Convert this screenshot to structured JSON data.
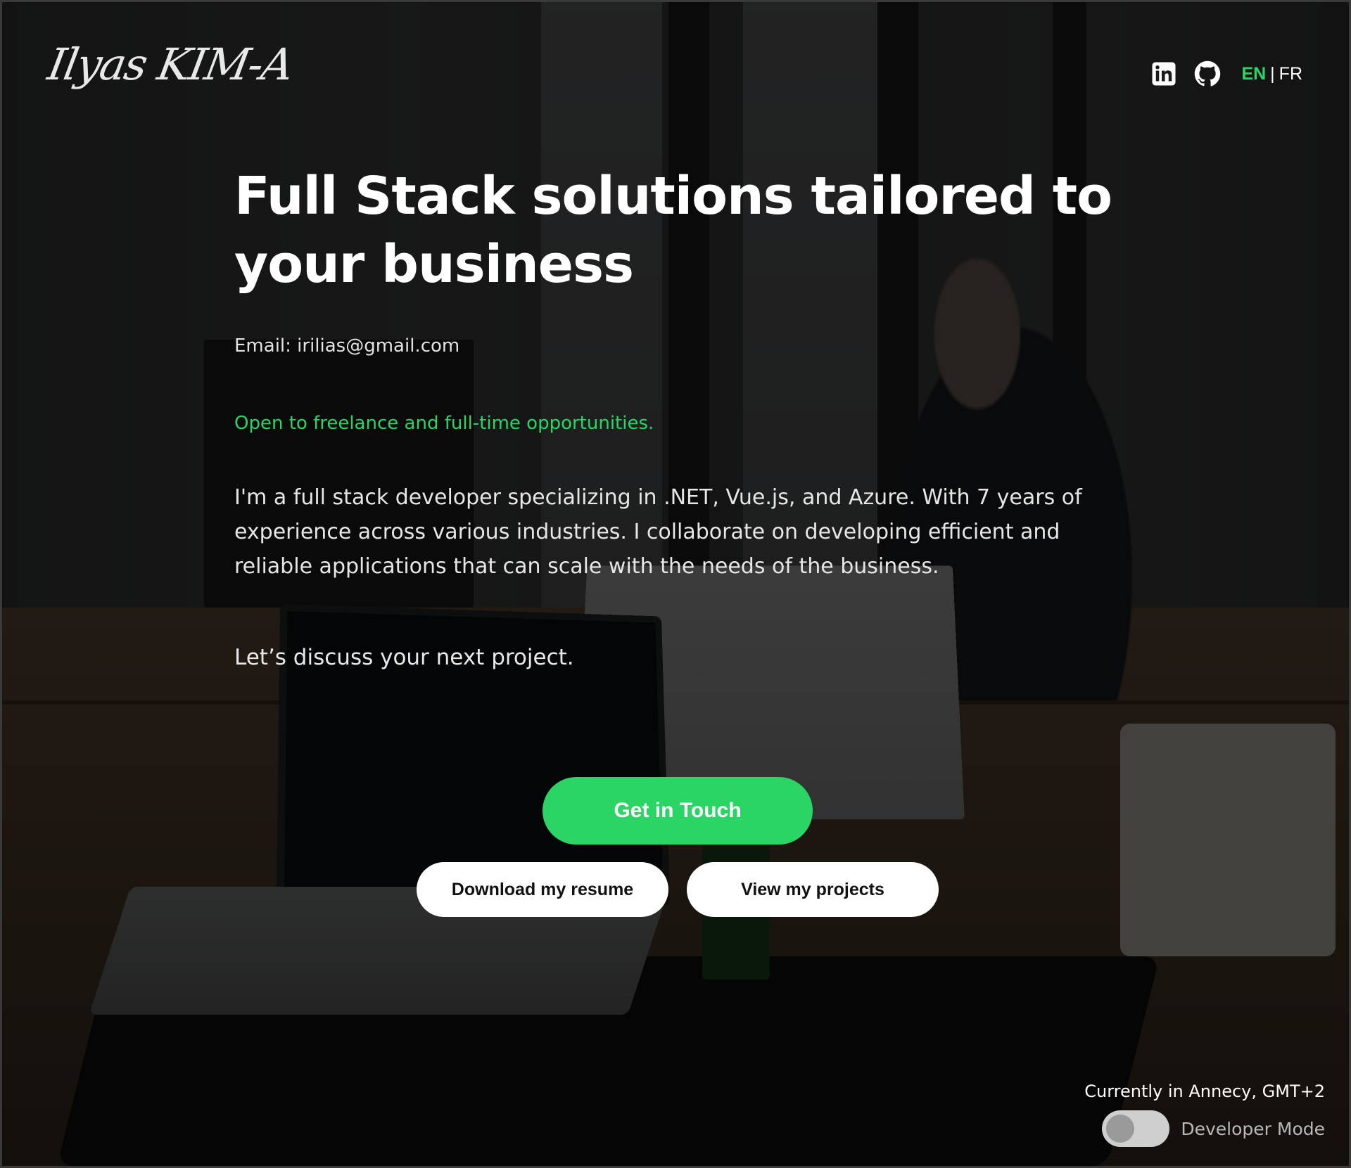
{
  "header": {
    "logo_text": "Ilyas KIM-A",
    "icons": [
      "linkedin-icon",
      "github-icon"
    ],
    "lang": {
      "active": "EN",
      "separator": "|",
      "inactive": "FR"
    }
  },
  "hero": {
    "headline": "Full Stack solutions tailored to your business",
    "email": "Email: irilias@gmail.com",
    "availability": "Open to freelance and full-time opportunities.",
    "bio": "I'm a full stack developer specializing in .NET, Vue.js, and Azure. With 7 years of experience across various industries. I collaborate on developing efficient and reliable applications that can scale with the needs of the business.",
    "cta_text": "Let’s discuss your next project."
  },
  "buttons": {
    "primary": "Get in Touch",
    "resume": "Download my resume",
    "projects": "View my projects"
  },
  "footer": {
    "location": "Currently in Annecy, GMT+2",
    "dev_mode_label": "Developer Mode",
    "dev_mode_on": false
  },
  "colors": {
    "accent": "#2bd565",
    "overlay": "#000000",
    "text": "#ffffff"
  }
}
